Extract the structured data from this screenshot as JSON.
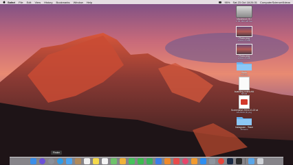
{
  "menubar": {
    "app_name": "Safari",
    "items": [
      "File",
      "Edit",
      "View",
      "History",
      "Bookmarks",
      "Window",
      "Help"
    ],
    "wifi_status": "WiFi",
    "battery": "95%",
    "clock": "Sat 23 Oct 18:26:31",
    "user": "ComputerScienceVideos"
  },
  "desktop": {
    "icons": [
      {
        "label": "Macintosh HD",
        "sub": "1 TB, 900 GB free",
        "icon": "hard-drive-icon"
      },
      {
        "label": "Photo.png",
        "sub": "2,560 x 1,600",
        "icon": "screenshot-icon"
      },
      {
        "label": "Photo.png",
        "sub": "2,560 x 1,600",
        "icon": "screenshot-icon"
      },
      {
        "label": "Work",
        "sub": "6 items",
        "icon": "folder-icon"
      },
      {
        "label": "boarding-notes.rtfd",
        "sub": "58 KB",
        "icon": "document-icon"
      },
      {
        "label": "Screenshot 2016-10-22 at",
        "sub": "18.28.03 (3).png",
        "icon": "pdf-icon"
      },
      {
        "label": "Instagram - Team",
        "sub": "10 items",
        "icon": "folder-icon"
      }
    ]
  },
  "dock": {
    "tooltip": "Finder",
    "apps": [
      {
        "icon": "finder-icon",
        "color": "#3b8ee8"
      },
      {
        "icon": "siri-icon",
        "color": "#6b4fd8"
      },
      {
        "icon": "launchpad-icon",
        "color": "#8a8f99"
      },
      {
        "icon": "safari-icon",
        "color": "#2f9be8"
      },
      {
        "icon": "mail-icon",
        "color": "#4aa3f0"
      },
      {
        "icon": "contacts-icon",
        "color": "#b08a5a"
      },
      {
        "icon": "calendar-icon",
        "color": "#f2f2f2"
      },
      {
        "icon": "notes-icon",
        "color": "#f5d94a"
      },
      {
        "icon": "reminders-icon",
        "color": "#f4f4f4"
      },
      {
        "icon": "maps-icon",
        "color": "#6fc26a"
      },
      {
        "icon": "photos-icon",
        "color": "#f0b23a"
      },
      {
        "icon": "messages-icon",
        "color": "#46c35b"
      },
      {
        "icon": "facetime-icon",
        "color": "#3dbb4f"
      },
      {
        "icon": "numbers-icon",
        "color": "#3bb35a"
      },
      {
        "icon": "keynote-icon",
        "color": "#3b7ee8"
      },
      {
        "icon": "pages-icon",
        "color": "#f08a2a"
      },
      {
        "icon": "news-icon",
        "color": "#e94a4a"
      },
      {
        "icon": "music-icon",
        "color": "#e8456a"
      },
      {
        "icon": "books-icon",
        "color": "#f29a2e"
      },
      {
        "icon": "appstore-icon",
        "color": "#2e8ef0"
      },
      {
        "icon": "preferences-icon",
        "color": "#8d949e"
      },
      {
        "icon": "chrome-icon",
        "color": "#e7453b"
      },
      {
        "icon": "photoshop-icon",
        "color": "#1a2a44"
      },
      {
        "icon": "terminal-icon",
        "color": "#2b2b2b"
      }
    ],
    "downloads_icon": "downloads-folder-icon",
    "trash_icon": "trash-icon"
  }
}
